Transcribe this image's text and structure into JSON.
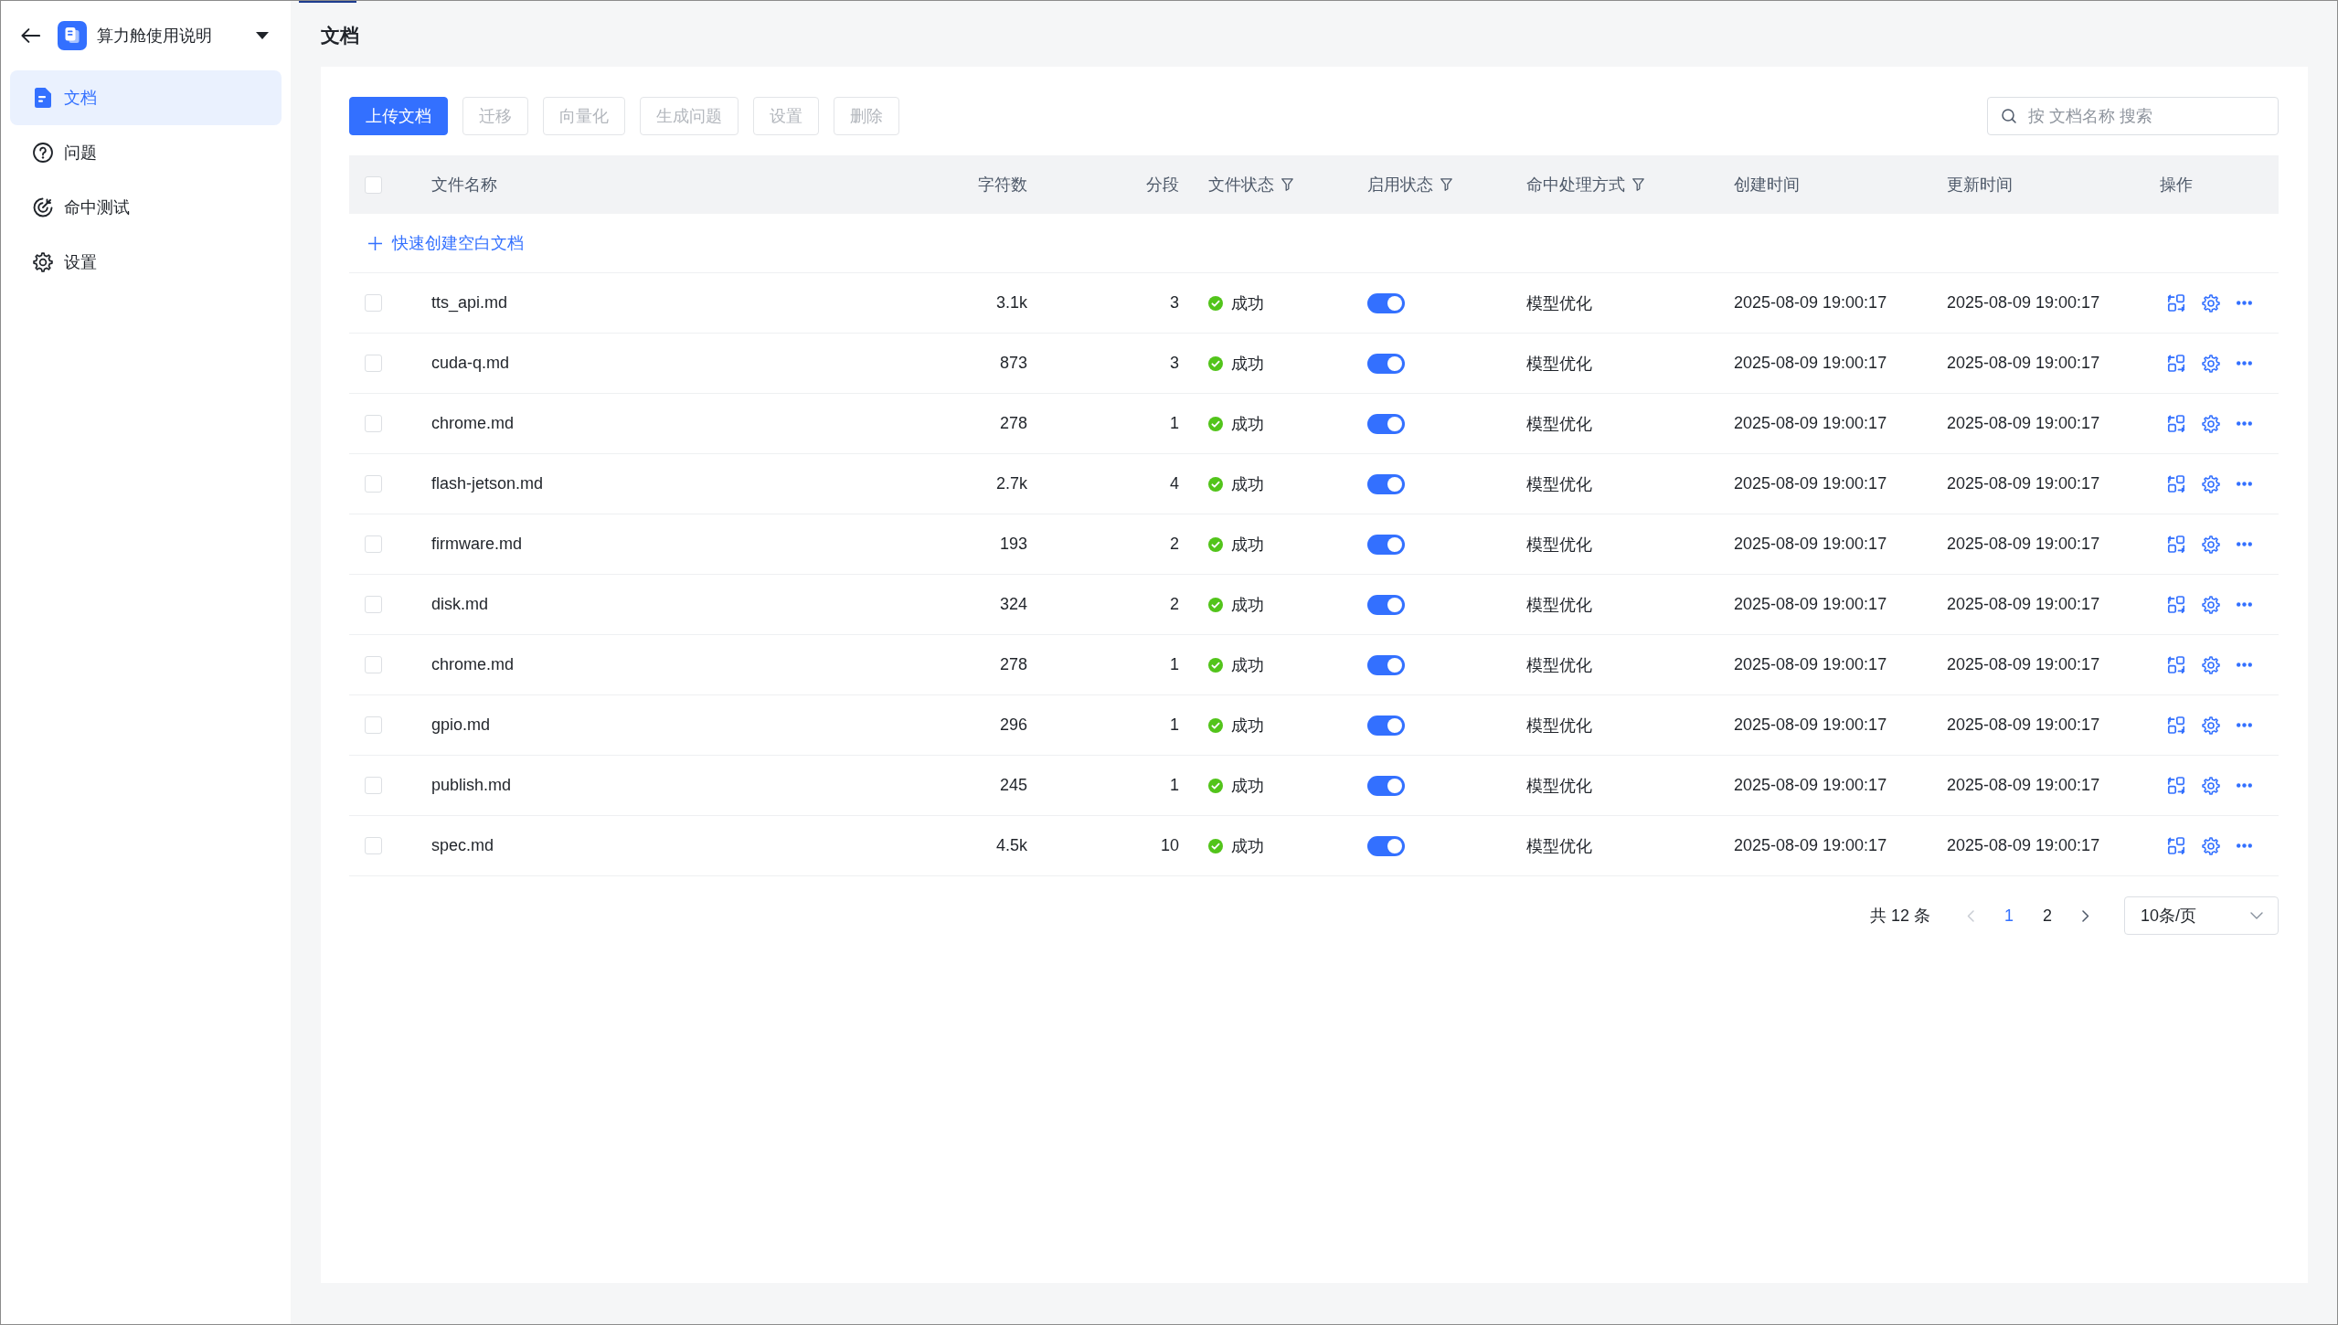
{
  "sidebar": {
    "title": "算力舱使用说明",
    "items": [
      {
        "label": "文档",
        "selected": true
      },
      {
        "label": "问题",
        "selected": false
      },
      {
        "label": "命中测试",
        "selected": false
      },
      {
        "label": "设置",
        "selected": false
      }
    ]
  },
  "page_title": "文档",
  "toolbar": {
    "buttons": [
      {
        "label": "上传文档",
        "kind": "primary",
        "disabled": false
      },
      {
        "label": "迁移",
        "kind": "default",
        "disabled": true
      },
      {
        "label": "向量化",
        "kind": "default",
        "disabled": true
      },
      {
        "label": "生成问题",
        "kind": "default",
        "disabled": true
      },
      {
        "label": "设置",
        "kind": "default",
        "disabled": true
      },
      {
        "label": "删除",
        "kind": "default",
        "disabled": true
      }
    ],
    "search": {
      "placeholder": "按 文档名称 搜索"
    }
  },
  "table": {
    "header_checkbox": {
      "checked": false
    },
    "columns": [
      {
        "label": "文件名称",
        "kind": "text",
        "filterable": false
      },
      {
        "label": "字符数",
        "kind": "number",
        "filterable": false
      },
      {
        "label": "分段",
        "kind": "number",
        "filterable": false
      },
      {
        "label": "文件状态",
        "kind": "text",
        "filterable": true
      },
      {
        "label": "启用状态",
        "kind": "text",
        "filterable": true
      },
      {
        "label": "命中处理方式",
        "kind": "text",
        "filterable": true
      },
      {
        "label": "创建时间",
        "kind": "text",
        "filterable": false
      },
      {
        "label": "更新时间",
        "kind": "text",
        "filterable": false
      },
      {
        "label": "操作",
        "kind": "text",
        "filterable": false
      }
    ],
    "quick_create": {
      "label": "快速创建空白文档"
    },
    "rows": [
      {
        "checked": false,
        "name": "tts_api.md",
        "chars": "3.1k",
        "segments": "3",
        "status": {
          "label": "成功",
          "color": "#52c41a"
        },
        "enabled": true,
        "hit_mode": "模型优化",
        "created": "2025-08-09 19:00:17",
        "updated": "2025-08-09 19:00:17"
      },
      {
        "checked": false,
        "name": "cuda-q.md",
        "chars": "873",
        "segments": "3",
        "status": {
          "label": "成功",
          "color": "#52c41a"
        },
        "enabled": true,
        "hit_mode": "模型优化",
        "created": "2025-08-09 19:00:17",
        "updated": "2025-08-09 19:00:17"
      },
      {
        "checked": false,
        "name": "chrome.md",
        "chars": "278",
        "segments": "1",
        "status": {
          "label": "成功",
          "color": "#52c41a"
        },
        "enabled": true,
        "hit_mode": "模型优化",
        "created": "2025-08-09 19:00:17",
        "updated": "2025-08-09 19:00:17"
      },
      {
        "checked": false,
        "name": "flash-jetson.md",
        "chars": "2.7k",
        "segments": "4",
        "status": {
          "label": "成功",
          "color": "#52c41a"
        },
        "enabled": true,
        "hit_mode": "模型优化",
        "created": "2025-08-09 19:00:17",
        "updated": "2025-08-09 19:00:17"
      },
      {
        "checked": false,
        "name": "firmware.md",
        "chars": "193",
        "segments": "2",
        "status": {
          "label": "成功",
          "color": "#52c41a"
        },
        "enabled": true,
        "hit_mode": "模型优化",
        "created": "2025-08-09 19:00:17",
        "updated": "2025-08-09 19:00:17"
      },
      {
        "checked": false,
        "name": "disk.md",
        "chars": "324",
        "segments": "2",
        "status": {
          "label": "成功",
          "color": "#52c41a"
        },
        "enabled": true,
        "hit_mode": "模型优化",
        "created": "2025-08-09 19:00:17",
        "updated": "2025-08-09 19:00:17"
      },
      {
        "checked": false,
        "name": "chrome.md",
        "chars": "278",
        "segments": "1",
        "status": {
          "label": "成功",
          "color": "#52c41a"
        },
        "enabled": true,
        "hit_mode": "模型优化",
        "created": "2025-08-09 19:00:17",
        "updated": "2025-08-09 19:00:17"
      },
      {
        "checked": false,
        "name": "gpio.md",
        "chars": "296",
        "segments": "1",
        "status": {
          "label": "成功",
          "color": "#52c41a"
        },
        "enabled": true,
        "hit_mode": "模型优化",
        "created": "2025-08-09 19:00:17",
        "updated": "2025-08-09 19:00:17"
      },
      {
        "checked": false,
        "name": "publish.md",
        "chars": "245",
        "segments": "1",
        "status": {
          "label": "成功",
          "color": "#52c41a"
        },
        "enabled": true,
        "hit_mode": "模型优化",
        "created": "2025-08-09 19:00:17",
        "updated": "2025-08-09 19:00:17"
      },
      {
        "checked": false,
        "name": "spec.md",
        "chars": "4.5k",
        "segments": "10",
        "status": {
          "label": "成功",
          "color": "#52c41a"
        },
        "enabled": true,
        "hit_mode": "模型优化",
        "created": "2025-08-09 19:00:17",
        "updated": "2025-08-09 19:00:17"
      }
    ]
  },
  "pagination": {
    "total": "共 12 条",
    "prev": {
      "disabled": true
    },
    "pages": [
      {
        "label": "1",
        "selected": true
      },
      {
        "label": "2",
        "selected": false
      }
    ],
    "next": {
      "disabled": false
    },
    "page_size": "10条/页"
  }
}
